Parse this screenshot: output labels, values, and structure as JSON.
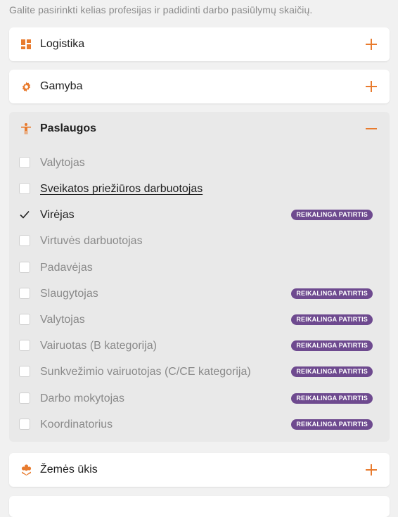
{
  "intro_text": "Galite pasirinkti kelias profesijas ir padidinti darbo pasiūlymų skaičių.",
  "accent_color": "#e87b2e",
  "badge_color": "#6e4a8f",
  "categories": [
    {
      "title": "Logistika",
      "icon": "grid-icon",
      "state": "collapsed"
    },
    {
      "title": "Gamyba",
      "icon": "gear-icon",
      "state": "collapsed"
    },
    {
      "title": "Paslaugos",
      "icon": "person-icon",
      "state": "expanded"
    },
    {
      "title": "Žemės ūkis",
      "icon": "flower-icon",
      "state": "collapsed"
    }
  ],
  "paslaugos_items": [
    {
      "label": "Valytojas",
      "checked": false,
      "badge": ""
    },
    {
      "label": "Sveikatos priežiūros darbuotojas",
      "checked": false,
      "badge": ""
    },
    {
      "label": "Virėjas",
      "checked": true,
      "badge": "REIKALINGA PATIRTIS"
    },
    {
      "label": "Virtuvės darbuotojas",
      "checked": false,
      "badge": ""
    },
    {
      "label": "Padavėjas",
      "checked": false,
      "badge": ""
    },
    {
      "label": "Slaugytojas",
      "checked": false,
      "badge": "REIKALINGA PATIRTIS"
    },
    {
      "label": "Valytojas",
      "checked": false,
      "badge": "REIKALINGA PATIRTIS"
    },
    {
      "label": "Vairuotas (B kategorija)",
      "checked": false,
      "badge": "REIKALINGA PATIRTIS"
    },
    {
      "label": "Sunkvežimio vairuotojas (C/CE kategorija)",
      "checked": false,
      "badge": "REIKALINGA PATIRTIS"
    },
    {
      "label": "Darbo mokytojas",
      "checked": false,
      "badge": "REIKALINGA PATIRTIS"
    },
    {
      "label": "Koordinatorius",
      "checked": false,
      "badge": "REIKALINGA PATIRTIS"
    }
  ]
}
